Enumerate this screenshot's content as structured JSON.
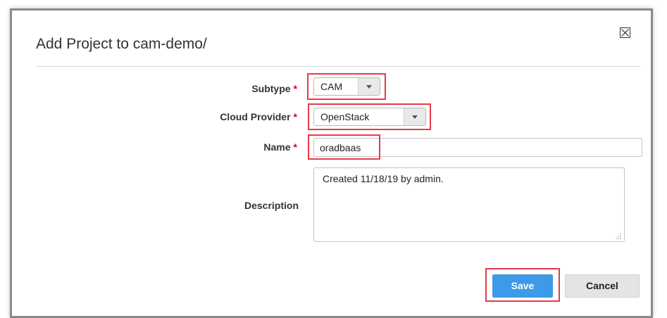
{
  "dialog": {
    "title": "Add Project to cam-demo/",
    "close_glyph": "⊠"
  },
  "form": {
    "required_mark": "*",
    "subtype": {
      "label": "Subtype",
      "value": "CAM"
    },
    "cloud_provider": {
      "label": "Cloud Provider",
      "value": "OpenStack"
    },
    "name": {
      "label": "Name",
      "value": "oradbaas"
    },
    "description": {
      "label": "Description",
      "value": "Created 11/18/19 by admin."
    }
  },
  "buttons": {
    "save": "Save",
    "cancel": "Cancel"
  },
  "colors": {
    "highlight": "#e8394a",
    "save_button": "#3d9ae8",
    "required": "#d0021b"
  },
  "icons": [
    "close-icon",
    "chevron-down-icon",
    "resize-grip-icon"
  ]
}
